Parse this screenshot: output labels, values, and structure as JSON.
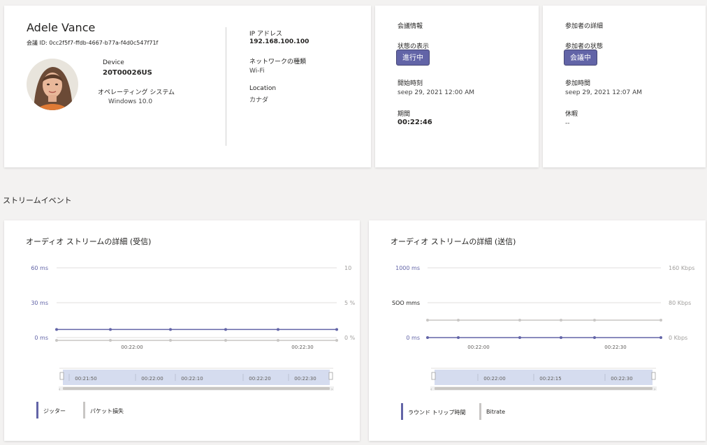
{
  "user": {
    "name": "Adele Vance",
    "meeting_id": "会議 ID: 0cc2f5f7-ffdb-4667-b77a-f4d0c547f71f",
    "device_label": "Device",
    "device_value": "20T00026US",
    "os_label": "オペレーティング システム",
    "os_value": "Windows 10.0",
    "ip_label": "IP アドレス",
    "ip_value": "192.168.100.100",
    "network_label": "ネットワークの種類",
    "network_value": "Wi-Fi",
    "location_label": "Location",
    "location_value": "カナダ"
  },
  "meeting_info": {
    "title": "会議情報",
    "status_label": "状態の表示",
    "status_value": "進行中",
    "start_label": "開始時刻",
    "start_value": "seep 29, 2021 12:00 AM",
    "duration_label": "期間",
    "duration_value": "00:22:46"
  },
  "participant": {
    "title": "参加者の詳細",
    "state_label": "参加者の状態",
    "state_value": "会議中",
    "join_label": "参加時間",
    "join_value": "seep 29, 2021 12:07 AM",
    "break_label": "休暇",
    "break_value": "--"
  },
  "stream_events_title": "ストリームイベント",
  "colors": {
    "accent": "#6264a7",
    "gray_series": "#c8c6c4",
    "nav_fill": "#d5dcef"
  },
  "chart_data": [
    {
      "type": "line",
      "title": "オーディオ ストリームの詳細 (受信)",
      "y_left_ticks": [
        "60 ms",
        "30 ms",
        "0 ms"
      ],
      "y_right_ticks": [
        "10",
        "5 %",
        "0 %"
      ],
      "x_ticks": [
        "00:22:00",
        "00:22:30"
      ],
      "navigator_ticks": [
        "00:21:50",
        "00:22:00",
        "00:22:10",
        "00:22:20",
        "00:22:30"
      ],
      "ylim_left": [
        0,
        60
      ],
      "ylim_right": [
        0,
        10
      ],
      "series": [
        {
          "name": "ジッター",
          "axis": "left",
          "color": "#6264a7",
          "values": [
            7,
            7,
            7,
            7,
            7,
            7
          ]
        },
        {
          "name": "パケット損失",
          "axis": "right",
          "color": "#c8c6c4",
          "values": [
            0,
            0,
            0,
            0,
            0,
            0
          ]
        }
      ],
      "grid": true,
      "legend": "bottom-left"
    },
    {
      "type": "line",
      "title": "オーディオ ストリームの詳細 (送信)",
      "y_left_ticks": [
        "1000 ms",
        "SOO mms",
        "0 ms"
      ],
      "y_right_ticks": [
        "160 Kbps",
        "80 Kbps",
        "0 Kbps"
      ],
      "x_ticks": [
        "00:22:00",
        "00:22:30"
      ],
      "navigator_ticks": [
        "00:22:00",
        "00:22:15",
        "00:22:30"
      ],
      "ylim_left": [
        0,
        1000
      ],
      "ylim_right": [
        0,
        160
      ],
      "series": [
        {
          "name": "ラウンド トリップ時間",
          "axis": "left",
          "color": "#6264a7",
          "values": [
            0,
            0,
            0,
            0,
            0,
            0
          ]
        },
        {
          "name": "Bitrate",
          "axis": "right",
          "color": "#c8c6c4",
          "values": [
            40,
            40,
            40,
            40,
            40,
            40
          ]
        }
      ],
      "grid": true,
      "legend": "bottom-left"
    }
  ]
}
